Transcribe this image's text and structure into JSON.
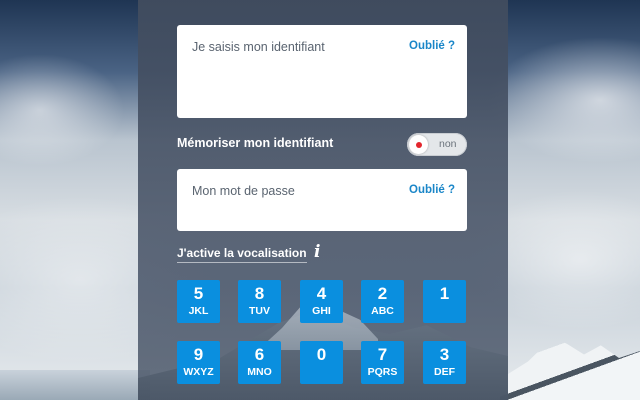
{
  "login": {
    "identifier_placeholder": "Je saisis mon identifiant",
    "identifier_forgot": "Oublié ?",
    "remember_label": "Mémoriser mon identifiant",
    "remember_state": "non",
    "password_placeholder": "Mon mot de passe",
    "password_forgot": "Oublié ?",
    "voice_label": "J'active la vocalisation",
    "info_icon_glyph": "i"
  },
  "keypad": {
    "color": "#0a8fdf",
    "row1": [
      {
        "number": "5",
        "letters": "JKL"
      },
      {
        "number": "8",
        "letters": "TUV"
      },
      {
        "number": "4",
        "letters": "GHI"
      },
      {
        "number": "2",
        "letters": "ABC"
      },
      {
        "number": "1",
        "letters": ""
      }
    ],
    "row2": [
      {
        "number": "9",
        "letters": "WXYZ"
      },
      {
        "number": "6",
        "letters": "MNO"
      },
      {
        "number": "0",
        "letters": ""
      },
      {
        "number": "7",
        "letters": "PQRS"
      },
      {
        "number": "3",
        "letters": "DEF"
      }
    ]
  }
}
